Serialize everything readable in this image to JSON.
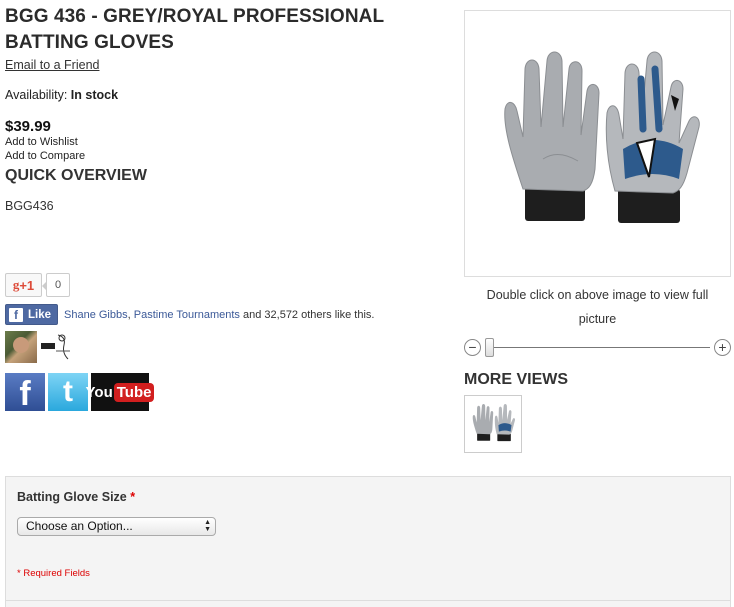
{
  "product": {
    "title": "BGG 436 - GREY/ROYAL PROFESSIONAL BATTING GLOVES",
    "email_link": "Email to a Friend",
    "availability_label": "Availability:",
    "availability_value": "In stock",
    "price": "$39.99",
    "wishlist_link": "Add to Wishlist",
    "compare_link": "Add to Compare",
    "overview_heading": "QUICK OVERVIEW",
    "sku": "BGG436"
  },
  "social": {
    "gplus_label": "+1",
    "gplus_count": "0",
    "fb_like_label": "Like",
    "fb_friend_1": "Shane Gibbs",
    "fb_separator": ",",
    "fb_friend_2": "Pastime Tournaments",
    "fb_others": "and 32,572 others like this.",
    "twitter_glyph": "t",
    "youtube_you": "You",
    "youtube_tube": "Tube"
  },
  "gallery": {
    "zoom_hint": "Double click on above image to view full picture",
    "zoom_level": 0,
    "more_views_heading": "MORE VIEWS"
  },
  "options": {
    "size_label": "Batting Glove Size",
    "required_star": "*",
    "select_value": "Choose an Option...",
    "required_note": "* Required Fields"
  },
  "colors": {
    "glove_grey": "#a9acb0",
    "glove_royal": "#2d5a8c",
    "required_red": "#dd0000",
    "facebook_blue": "#4e69a2"
  }
}
